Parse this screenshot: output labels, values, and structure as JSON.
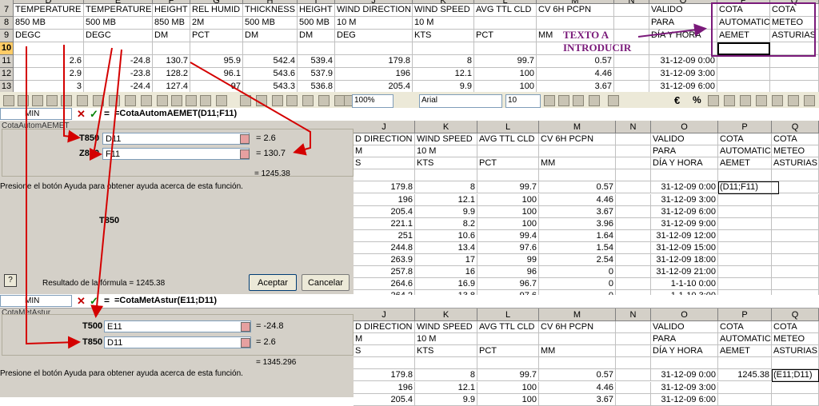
{
  "top_grid": {
    "columns": [
      "D",
      "E",
      "F",
      "G",
      "H",
      "I",
      "J",
      "K",
      "L",
      "M",
      "N",
      "O",
      "P",
      "Q"
    ],
    "rows": [
      {
        "n": "7",
        "cells": [
          "TEMPERATURE",
          "TEMPERATURE",
          "HEIGHT",
          "REL HUMID",
          "THICKNESS",
          "HEIGHT",
          "WIND DIRECTION",
          "WIND SPEED",
          "AVG TTL CLD",
          "CV 6H PCPN",
          "",
          "VALIDO",
          "COTA",
          "COTA"
        ]
      },
      {
        "n": "8",
        "cells": [
          "850 MB",
          "500 MB",
          "850 MB",
          "2M",
          "500 MB",
          "500 MB",
          "10 M",
          "10 M",
          "",
          "",
          "",
          "PARA",
          "AUTOMATIC",
          "METEO"
        ]
      },
      {
        "n": "9",
        "cells": [
          "DEGC",
          "DEGC",
          "DM",
          "PCT",
          "DM",
          "DM",
          "DEG",
          "KTS",
          "PCT",
          "MM",
          "",
          "DÍA Y HORA",
          "AEMET",
          "ASTURIAS"
        ]
      },
      {
        "n": "10",
        "cells": [
          "",
          "",
          "",
          "",
          "",
          "",
          "",
          "",
          "",
          "",
          "",
          "",
          "",
          ""
        ]
      },
      {
        "n": "11",
        "cells": [
          "2.6",
          "-24.8",
          "130.7",
          "95.9",
          "542.4",
          "539.4",
          "179.8",
          "8",
          "99.7",
          "0.57",
          "",
          "31-12-09 0:00",
          "",
          ""
        ]
      },
      {
        "n": "12",
        "cells": [
          "2.9",
          "-23.8",
          "128.2",
          "96.1",
          "543.6",
          "537.9",
          "196",
          "12.1",
          "100",
          "4.46",
          "",
          "31-12-09 3:00",
          "",
          ""
        ]
      },
      {
        "n": "13",
        "cells": [
          "3",
          "-24.4",
          "127.4",
          "97",
          "543.3",
          "536.8",
          "205.4",
          "9.9",
          "100",
          "3.67",
          "",
          "31-12-09 6:00",
          "",
          ""
        ]
      }
    ]
  },
  "annotation": {
    "line1": "TEXTO A",
    "line2": "INTRODUCIR"
  },
  "toolbar": {
    "zoom": "100%",
    "font": "Arial",
    "size": "10"
  },
  "dialog1": {
    "namebox": "MIN",
    "formula": "=CotaAutomAEMET(D11;F11)",
    "title": "CotaAutomAEMET",
    "arg1_label": "T850",
    "arg1_value": "D11",
    "arg1_result": "= 2.6",
    "arg2_label": "Z850",
    "arg2_value": "F11",
    "arg2_result": "= 130.7",
    "result": "= 1245.38",
    "help_text": "Presione el botón Ayuda para obtener ayuda acerca de esta función.",
    "param_label": "T850",
    "formula_result": "Resultado de la fórmula = 1245.38",
    "ok": "Aceptar",
    "cancel": "Cancelar",
    "help_icon": "?"
  },
  "mid_grid": {
    "columns": [
      "J",
      "K",
      "L",
      "M",
      "N",
      "O",
      "P",
      "Q"
    ],
    "rows": [
      [
        "D DIRECTION",
        "WIND SPEED",
        "AVG TTL CLD",
        "CV 6H PCPN",
        "",
        "VALIDO",
        "COTA",
        "COTA"
      ],
      [
        "M",
        "10 M",
        "",
        "",
        "",
        "PARA",
        "AUTOMATIC",
        "METEO"
      ],
      [
        "S",
        "KTS",
        "PCT",
        "MM",
        "",
        "DÍA Y HORA",
        "AEMET",
        "ASTURIAS"
      ],
      [
        "",
        "",
        "",
        "",
        "",
        "",
        "",
        ""
      ],
      [
        "179.8",
        "8",
        "99.7",
        "0.57",
        "",
        "31-12-09 0:00",
        "(D11;F11)",
        ""
      ],
      [
        "196",
        "12.1",
        "100",
        "4.46",
        "",
        "31-12-09 3:00",
        "",
        ""
      ],
      [
        "205.4",
        "9.9",
        "100",
        "3.67",
        "",
        "31-12-09 6:00",
        "",
        ""
      ],
      [
        "221.1",
        "8.2",
        "100",
        "3.96",
        "",
        "31-12-09 9:00",
        "",
        ""
      ],
      [
        "251",
        "10.6",
        "99.4",
        "1.64",
        "",
        "31-12-09 12:00",
        "",
        ""
      ],
      [
        "244.8",
        "13.4",
        "97.6",
        "1.54",
        "",
        "31-12-09 15:00",
        "",
        ""
      ],
      [
        "263.9",
        "17",
        "99",
        "2.54",
        "",
        "31-12-09 18:00",
        "",
        ""
      ],
      [
        "257.8",
        "16",
        "96",
        "0",
        "",
        "31-12-09 21:00",
        "",
        ""
      ],
      [
        "264.6",
        "16.9",
        "96.7",
        "0",
        "",
        "1-1-10 0:00",
        "",
        ""
      ],
      [
        "264.2",
        "13.8",
        "97.6",
        "0",
        "",
        "1-1-10 3:00",
        "",
        ""
      ]
    ]
  },
  "dialog2": {
    "namebox": "MIN",
    "formula": "=CotaMetAstur(E11;D11)",
    "title": "CotaMetAstur",
    "arg1_label": "T500",
    "arg1_value": "E11",
    "arg1_result": "= -24.8",
    "arg2_label": "T850",
    "arg2_value": "D11",
    "arg2_result": "= 2.6",
    "result": "= 1345.296",
    "help_text": "Presione el botón Ayuda para obtener ayuda acerca de esta función."
  },
  "bot_grid": {
    "columns": [
      "J",
      "K",
      "L",
      "M",
      "N",
      "O",
      "P",
      "Q"
    ],
    "rows": [
      [
        "D DIRECTION",
        "WIND SPEED",
        "AVG TTL CLD",
        "CV 6H PCPN",
        "",
        "VALIDO",
        "COTA",
        "COTA"
      ],
      [
        "M",
        "10 M",
        "",
        "",
        "",
        "PARA",
        "AUTOMATIC",
        "METEO"
      ],
      [
        "S",
        "KTS",
        "PCT",
        "MM",
        "",
        "DÍA Y HORA",
        "AEMET",
        "ASTURIAS"
      ],
      [
        "",
        "",
        "",
        "",
        "",
        "",
        "",
        ""
      ],
      [
        "179.8",
        "8",
        "99.7",
        "0.57",
        "",
        "31-12-09 0:00",
        "1245.38",
        "(E11;D11)"
      ],
      [
        "196",
        "12.1",
        "100",
        "4.46",
        "",
        "31-12-09 3:00",
        "",
        ""
      ],
      [
        "205.4",
        "9.9",
        "100",
        "3.67",
        "",
        "31-12-09 6:00",
        "",
        ""
      ]
    ]
  },
  "colors": {
    "arrow": "#d40000",
    "annotation": "#7a1a7a",
    "header": "#d4d0c8"
  }
}
